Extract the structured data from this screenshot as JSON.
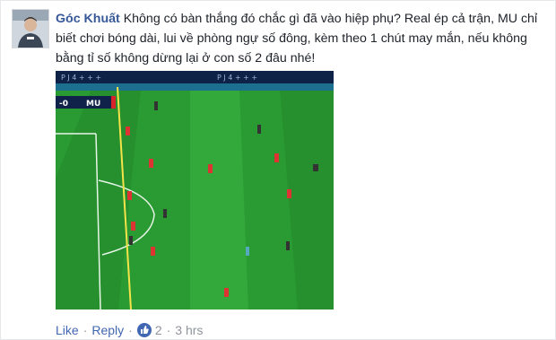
{
  "comment": {
    "author": "Góc Khuất",
    "text": "Không có bàn thắng đó chắc gì đã vào hiệp phụ? Real ép cả trận, MU chỉ biết chơi bóng dài, lui về phòng ngự số đông, kèm theo 1 chút may mắn, nếu không bằng tỉ số không dừng lại ở con số 2 đâu nhé!"
  },
  "photo": {
    "scoreboard": {
      "score": "-0",
      "team": "MU"
    }
  },
  "actions": {
    "like_label": "Like",
    "separator": "·",
    "reply_label": "Reply",
    "like_count": "2",
    "time": "3 hrs"
  },
  "colors": {
    "author_link": "#365899",
    "action_link": "#4267b2",
    "muted": "#90949c",
    "pitch_dark": "#1f8a2a",
    "pitch_light": "#2ea336"
  }
}
